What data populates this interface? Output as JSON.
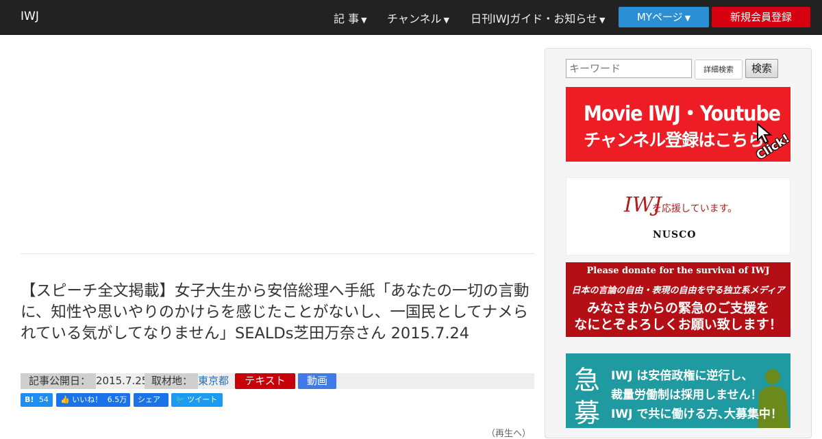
{
  "nav": {
    "brand": "IWJ",
    "items": [
      {
        "label": "記 事"
      },
      {
        "label": "チャンネル"
      },
      {
        "label": "日刊IWJガイド・お知らせ"
      }
    ],
    "mypage_label": "MYページ",
    "register_label": "新規会員登録"
  },
  "article": {
    "title": "【スピーチ全文掲載】女子大生から安倍総理へ手紙「あなたの一切の言動に、知性や思いやりのかけらを感じたことがないし、一国民としてナメられている気がしてなりません」SEALDs芝田万奈さん 2015.7.24",
    "published_label": "記事公開日：",
    "published_date": "2015.7.25",
    "location_label": "取材地：",
    "location": "東京都",
    "tag_text": "テキスト",
    "tag_video": "動画",
    "more_text": "（再生へ）"
  },
  "social": {
    "hatena": "54",
    "like_label": "いいね！",
    "like_count": "6.5万",
    "share_label": "シェア",
    "tweet_label": "ツイート"
  },
  "sidebar": {
    "search_placeholder": "キーワード",
    "advanced_search_label": "詳細検索",
    "search_button_label": "検索",
    "youtube_line1": "Movie IWJ・Youtube",
    "youtube_line2": "チャンネル登録はこちら",
    "youtube_click": "Click!",
    "nusco_iwj": "IWJ",
    "nusco_support": "を応援しています。",
    "nusco_name": "NUSCO",
    "donate_line1": "Please donate for the survival of IWJ",
    "donate_line2": "日本の言論の自由・表現の自由を守る独立系メディア",
    "donate_line3": "みなさまからの緊急のご支援を",
    "donate_line4": "なにとぞよろしくお願い致します！",
    "recruit_kyu": "急",
    "recruit_bo": "募",
    "recruit_line1": "IWJ は安倍政権に逆行し、",
    "recruit_line2": "裁量労働制は採用しません！",
    "recruit_line3": "IWJ で共に働ける方､大募集中！"
  },
  "colors": {
    "topbar": "#222222",
    "mypage": "#2b8fd6",
    "register": "#d6000f",
    "youtube_banner": "#ee1c25",
    "donate_banner": "#b40f15",
    "recruit_banner": "#1f9aa0"
  }
}
